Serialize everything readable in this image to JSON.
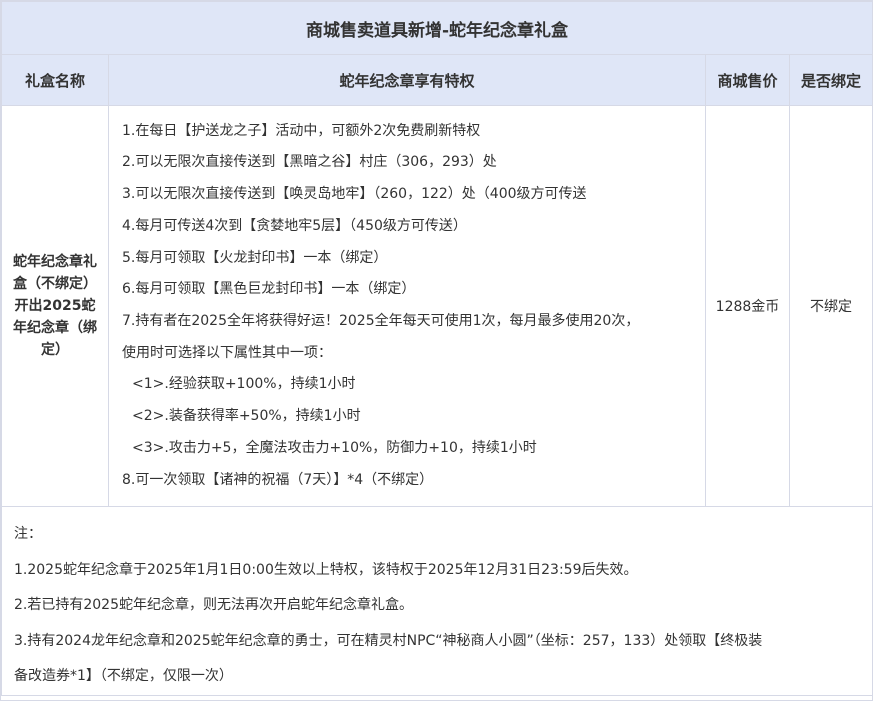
{
  "title": "商城售卖道具新增-蛇年纪念章礼盒",
  "headers": [
    "礼盒名称",
    "蛇年纪念章享有特权",
    "商城售价",
    "是否绑定"
  ],
  "row": {
    "name": "蛇年纪念章礼盒（不绑定）开出2025蛇年纪念章（绑定）",
    "privileges": [
      "1.在每日【护送龙之子】活动中，可额外2次免费刷新特权",
      "2.可以无限次直接传送到【黑暗之谷】村庄（306，293）处",
      "3.可以无限次直接传送到【唤灵岛地牢】（260，122）处（400级方可传送",
      "4.每月可传送4次到【贪婪地牢5层】（450级方可传送）",
      "5.每月可领取【火龙封印书】一本（绑定）",
      "6.每月可领取【黑色巨龙封印书】一本（绑定）",
      "7.持有者在2025全年将获得好运！2025全年每天可使用1次，每月最多使用20次，",
      "使用时可选择以下属性其中一项：",
      "<1>.经验获取+100%，持续1小时",
      "<2>.装备获得率+50%，持续1小时",
      "<3>.攻击力+5，全魔法攻击力+10%，防御力+10，持续1小时",
      "8.可一次领取【诸神的祝福（7天）】*4（不绑定）"
    ],
    "price": "1288金币",
    "bind": "不绑定"
  },
  "notes": [
    "注：",
    "1.2025蛇年纪念章于2025年1月1日0:00生效以上特权，该特权于2025年12月31日23:59后失效。",
    "2.若已持有2025蛇年纪念章，则无法再次开启蛇年纪念章礼盒。",
    "3.持有2024龙年纪念章和2025蛇年纪念章的勇士，可在精灵村NPC“神秘商人小圆”（坐标：257，133）处领取【终极装",
    "备改造券*1】（不绑定，仅限一次）"
  ],
  "colors": {
    "header_bg": "#dfe6f7",
    "border": "#d6d9e6",
    "text": "#333333"
  }
}
